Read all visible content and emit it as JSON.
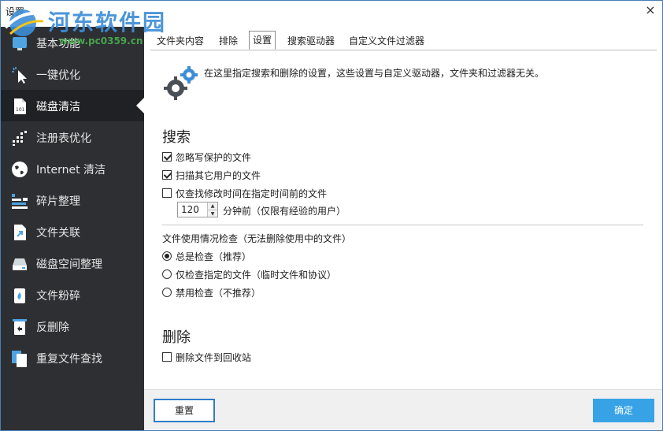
{
  "window": {
    "title": "设置",
    "close_label": "×",
    "watermark": "河东软件园",
    "watermark_url": "www.pc0359.cn"
  },
  "sidebar": {
    "items": [
      {
        "label": "基本功能",
        "icon": "basic-function-icon"
      },
      {
        "label": "一键优化",
        "icon": "cursor-sparkle-icon"
      },
      {
        "label": "磁盘清洁",
        "icon": "disk-file-icon",
        "active": true
      },
      {
        "label": "注册表优化",
        "icon": "registry-dots-icon"
      },
      {
        "label": "Internet 清洁",
        "icon": "globe-icon"
      },
      {
        "label": "碎片整理",
        "icon": "defrag-icon"
      },
      {
        "label": "文件关联",
        "icon": "file-link-icon"
      },
      {
        "label": "磁盘空间整理",
        "icon": "drive-icon"
      },
      {
        "label": "文件粉碎",
        "icon": "shredder-icon"
      },
      {
        "label": "反删除",
        "icon": "undelete-icon"
      },
      {
        "label": "重复文件查找",
        "icon": "duplicate-files-icon"
      }
    ]
  },
  "tabs": [
    {
      "label": "文件夹内容"
    },
    {
      "label": "排除"
    },
    {
      "label": "设置",
      "active": true
    },
    {
      "label": "搜索驱动器"
    },
    {
      "label": "自定义文件过滤器"
    }
  ],
  "settings": {
    "info": "在这里指定搜索和删除的设置，这些设置与自定义驱动器，文件夹和过滤器无关。",
    "search": {
      "title": "搜索",
      "ignore_write_protected": {
        "label": "忽略写保护的文件",
        "checked": true
      },
      "scan_other_users": {
        "label": "扫描其它用户的文件",
        "checked": true
      },
      "only_modified_before": {
        "label": "仅查找修改时间在指定时间前的文件",
        "checked": false
      },
      "minutes_value": "120",
      "minutes_suffix": "分钟前（仅限有经验的用户）"
    },
    "usage_check": {
      "label": "文件使用情况检查（无法删除使用中的文件）",
      "options": [
        {
          "label": "总是检查（推荐）",
          "selected": true
        },
        {
          "label": "仅检查指定的文件（临时文件和协议）",
          "selected": false
        },
        {
          "label": "禁用检查（不推荐）",
          "selected": false
        }
      ]
    },
    "delete": {
      "title": "删除",
      "to_recycle_bin": {
        "label": "删除文件到回收站",
        "checked": false
      }
    }
  },
  "footer": {
    "reset_label": "重置",
    "ok_label": "确定"
  },
  "colors": {
    "sidebar_bg": "#2d2f33",
    "accent": "#37a3e6",
    "watermark": "#3d8ed6"
  }
}
